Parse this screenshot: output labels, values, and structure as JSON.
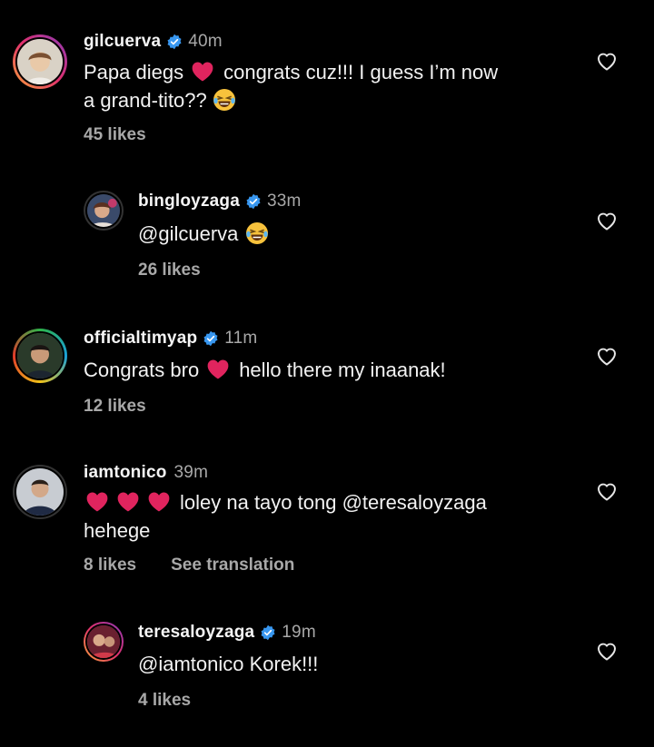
{
  "comments": [
    {
      "username": "gilcuerva",
      "verified": true,
      "time": "40m",
      "parts": {
        "a": "Papa diegs",
        "b": "congrats cuz!!! I guess I’m now",
        "c": "a grand-tito??"
      },
      "likes": "45 likes"
    },
    {
      "username": "bingloyzaga",
      "verified": true,
      "time": "33m",
      "parts": {
        "a": "@gilcuerva"
      },
      "likes": "26 likes"
    },
    {
      "username": "officialtimyap",
      "verified": true,
      "time": "11m",
      "parts": {
        "a": "Congrats bro",
        "b": "hello there my inaanak!"
      },
      "likes": "12 likes"
    },
    {
      "username": "iamtonico",
      "verified": false,
      "time": "39m",
      "parts": {
        "a": "loley na tayo tong @teresaloyzaga",
        "b": "hehege"
      },
      "likes": "8 likes",
      "translate": "See translation"
    },
    {
      "username": "teresaloyzaga",
      "verified": true,
      "time": "19m",
      "parts": {
        "a": "@iamtonico Korek!!!"
      },
      "likes": "4 likes"
    }
  ],
  "colors": {
    "background": "#000000",
    "verified": "#3897f0",
    "heart_emoji": "#e0245e",
    "muted": "#a8a8a8"
  },
  "icons": {
    "like": "heart-outline-icon",
    "verified": "verified-badge-icon",
    "emoji_heart": "red-heart-emoji",
    "emoji_laugh": "tears-of-joy-emoji"
  }
}
